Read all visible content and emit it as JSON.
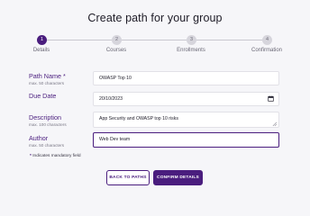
{
  "page": {
    "title": "Create path for your group"
  },
  "stepper": {
    "steps": [
      {
        "number": "1",
        "label": "Details",
        "active": true
      },
      {
        "number": "2",
        "label": "Courses",
        "active": false
      },
      {
        "number": "3",
        "label": "Enrollments",
        "active": false
      },
      {
        "number": "4",
        "label": "Confirmation",
        "active": false
      }
    ]
  },
  "form": {
    "path_name": {
      "label": "Path Name *",
      "hint": "max. 50 characters",
      "value": "OWASP Top 10"
    },
    "due_date": {
      "label": "Due Date",
      "value": "20/10/2023",
      "icon": "calendar-icon"
    },
    "description": {
      "label": "Description",
      "hint": "max. 100 characters",
      "value": "App Security and OWASP top 10 risks"
    },
    "author": {
      "label": "Author",
      "hint": "max. 50 characters",
      "value": "Web Dev team"
    },
    "mandatory_star": "*",
    "mandatory_note": "Indicates mandatory field"
  },
  "actions": {
    "back_label": "BACK TO PATHS",
    "confirm_label": "CONFIRM DETAILS"
  },
  "colors": {
    "accent": "#4a1d7e",
    "inactive_step": "#d6d5dc",
    "background": "#f6f6f9"
  }
}
